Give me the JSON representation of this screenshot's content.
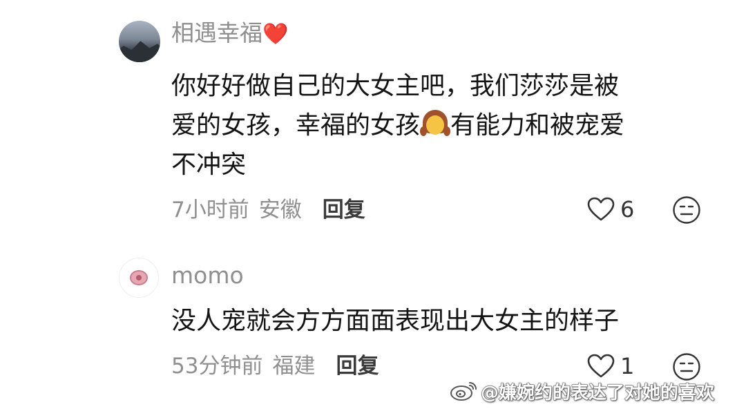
{
  "comments": [
    {
      "username": "相遇幸福",
      "username_emoji": "❤️",
      "text_lines": [
        "你好好做自己的大女主吧，我们莎莎是被",
        "爱的女孩，幸福的女孩",
        "有能力和被宠爱",
        "不冲突"
      ],
      "time": "7小时前",
      "location": "安徽",
      "reply_label": "回复",
      "like_count": "6"
    },
    {
      "username": "momo",
      "text": "没人宠就会方方面面表现出大女主的样子",
      "time": "53分钟前",
      "location": "福建",
      "reply_label": "回复",
      "like_count": "1"
    }
  ],
  "watermark": {
    "text": "@嫌婉约的表达了对她的喜欢"
  },
  "icons": {
    "heart": "heart-outline-icon",
    "dislike": "neutral-face-icon",
    "girl": "girl-emoji"
  },
  "colors": {
    "username": "#8f8f8f",
    "text": "#141414",
    "heart_emoji": "#e3403f"
  }
}
